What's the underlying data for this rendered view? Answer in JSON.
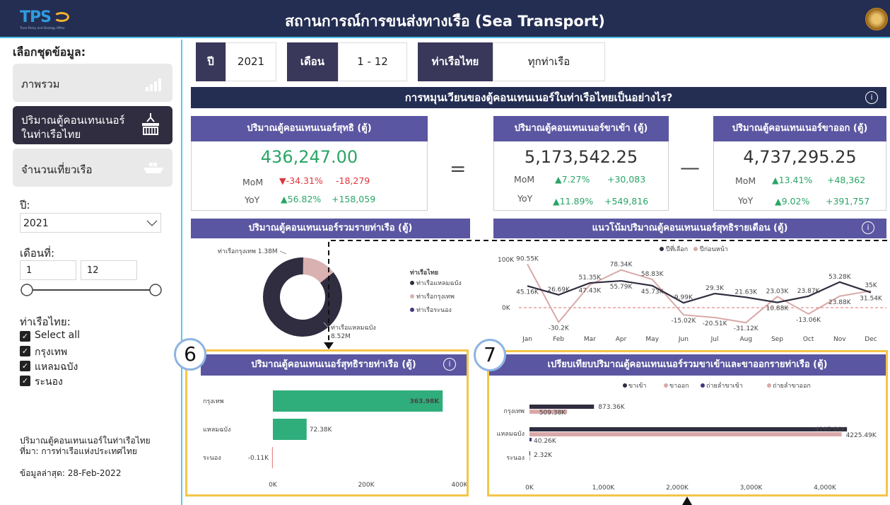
{
  "header": {
    "logo_text": "TPS",
    "logo_sub": "Trans Policy and Strategy Office",
    "title": "สถานการณ์การขนส่งทางเรือ (Sea Transport)"
  },
  "sidebar": {
    "select_title": "เลือกชุดข้อมูล:",
    "buttons": [
      {
        "label": "ภาพรวม",
        "icon": "bar-chart-icon",
        "active": false
      },
      {
        "label_line1": "ปริมาณตู้คอนเทนเนอร์",
        "label_line2": "ในท่าเรือไทย",
        "icon": "container-crane-icon",
        "active": true
      },
      {
        "label": "จำนวนเที่ยวเรือ",
        "icon": "ship-icon",
        "active": false
      }
    ],
    "year_label": "ปี:",
    "year_value": "2021",
    "month_label": "เดือนที่:",
    "month_from": "1",
    "month_to": "12",
    "port_label": "ท่าเรือไทย:",
    "ports": [
      "Select all",
      "กรุงเทพ",
      "แหลมฉบัง",
      "ระนอง"
    ],
    "note_line1": "ปริมาณตู้คอนเทนเนอร์ในท่าเรือไทย",
    "note_line2": "ที่มา: การท่าเรือแห่งประเทศไทย",
    "updated": "ข้อมูลล่าสุด: 28-Feb-2022"
  },
  "filters": {
    "year_label": "ปี",
    "year_value": "2021",
    "month_label": "เดือน",
    "month_value": "1 - 12",
    "port_label": "ท่าเรือไทย",
    "port_value": "ทุกท่าเรือ"
  },
  "banner": {
    "title": "การหมุนเวียนของตู้คอนเทนเนอร์ในท่าเรือไทยเป็นอย่างไร?",
    "info": "i"
  },
  "kpis": {
    "net": {
      "title": "ปริมาณตู้คอนเทนเนอร์สุทธิ (ตู้)",
      "value": "436,247.00",
      "mom_label": "MoM",
      "mom_pct": "▼-34.31%",
      "mom_abs": "-18,279",
      "yoy_label": "YoY",
      "yoy_pct": "▲56.82%",
      "yoy_abs": "+158,059"
    },
    "equals": "=",
    "minus": "—",
    "import": {
      "title": "ปริมาณตู้คอนเทนเนอร์ขาเข้า (ตู้)",
      "value": "5,173,542.25",
      "mom_label": "MoM",
      "mom_pct": "▲7.27%",
      "mom_abs": "+30,083",
      "yoy_label": "YoY",
      "yoy_pct": "▲11.89%",
      "yoy_abs": "+549,816"
    },
    "export": {
      "title": "ปริมาณตู้คอนเทนเนอร์ขาออก (ตู้)",
      "value": "4,737,295.25",
      "mom_label": "MoM",
      "mom_pct": "▲13.41%",
      "mom_abs": "+48,362",
      "yoy_label": "YoY",
      "yoy_pct": "▲9.02%",
      "yoy_abs": "+391,757"
    }
  },
  "chart_data": [
    {
      "type": "pie",
      "title": "ปริมาณตู้คอนเทนเนอร์รวมรายท่าเรือ (ตู้)",
      "legend_title": "ท่าเรือไทย",
      "legend_position": "right",
      "slices": [
        {
          "name": "ท่าเรือแหลมฉบัง",
          "label": "ท่าเรือแหลมฉบัง 8.52M",
          "value": 8.52,
          "color": "#2f2d3f"
        },
        {
          "name": "ท่าเรือกรุงเทพ",
          "label": "ท่าเรือกรุงเทพ 1.38M",
          "value": 1.38,
          "color": "#d9b1b1"
        },
        {
          "name": "ท่าเรือระนอง",
          "label": "",
          "value": 0.004,
          "color": "#3c3a7a"
        }
      ]
    },
    {
      "type": "line",
      "title": "แนวโน้มปริมาณตู้คอนเทนเนอร์สุทธิรายเดือน (ตู้)",
      "legend_position": "top",
      "categories": [
        "Jan",
        "Feb",
        "Mar",
        "Apr",
        "May",
        "Jun",
        "Jul",
        "Aug",
        "Sep",
        "Oct",
        "Nov",
        "Dec"
      ],
      "y_ticks": [
        "100K",
        "0K"
      ],
      "ylim": [
        -50,
        110
      ],
      "grid": false,
      "series": [
        {
          "name": "ปีที่เลือก",
          "color": "#2f2d3f",
          "values": [
            45.16,
            26.69,
            51.35,
            55.79,
            45.73,
            9.99,
            29.3,
            21.63,
            10.88,
            23.87,
            53.28,
            31.54
          ],
          "labels": [
            "45.16K",
            "26.69K",
            "51.35K",
            "55.79K",
            "45.73K",
            "9.99K",
            "29.3K",
            "21.63K",
            "10.88K",
            "23.87K",
            "53.28K",
            "31.54K"
          ]
        },
        {
          "name": "ปีก่อนหน้า",
          "color": "#d9a8a8",
          "values": [
            90.55,
            -30.2,
            47.43,
            78.34,
            58.83,
            -15.02,
            -20.51,
            -31.12,
            23.03,
            -13.06,
            23.88,
            35
          ],
          "labels": [
            "90.55K",
            "-30.2K",
            "47.43K",
            "78.34K",
            "58.83K",
            "-15.02K",
            "-20.51K",
            "-31.12K",
            "23.03K",
            "-13.06K",
            "23.88K",
            "35K"
          ]
        }
      ]
    },
    {
      "type": "bar",
      "title": "ปริมาณตู้คอนเทนเนอร์สุทธิรายท่าเรือ (ตู้)",
      "orientation": "horizontal",
      "categories": [
        "กรุงเทพ",
        "แหลมฉบัง",
        "ระนอง"
      ],
      "values": [
        363.98,
        72.38,
        -0.11
      ],
      "labels": [
        "363.98K",
        "72.38K",
        "-0.11K"
      ],
      "x_ticks": [
        "0K",
        "200K",
        "400K"
      ],
      "xlim": [
        0,
        400
      ],
      "color": "#2fae7c"
    },
    {
      "type": "bar",
      "title": "เปรียบเทียบปริมาณตู้คอนเทนเนอร์รวมขาเข้าและขาออกรายท่าเรือ (ตู้)",
      "orientation": "horizontal",
      "categories": [
        "กรุงเทพ",
        "แหลมฉบัง",
        "ระนอง"
      ],
      "x_ticks": [
        "0K",
        "1,000K",
        "2,000K",
        "3,000K",
        "4,000K"
      ],
      "xlim": [
        0,
        4800
      ],
      "legend_position": "top",
      "legend": [
        "ขาเข้า",
        "ขาออก",
        "ถ่ายลำขาเข้า",
        "ถ่ายลำขาออก"
      ],
      "series": [
        {
          "name": "ขาเข้า",
          "color": "#2f2d3f",
          "values": [
            873.36,
            4297.86,
            2.32
          ],
          "labels": [
            "873.36K",
            "4297.86K",
            "2.32K"
          ]
        },
        {
          "name": "ขาออก",
          "color": "#d9a8a8",
          "values": [
            509.38,
            4225.49,
            2.32
          ],
          "labels": [
            "509.38K",
            "4225.49K",
            ""
          ]
        }
      ],
      "extra_labels": [
        "40.26K"
      ]
    }
  ],
  "badges": {
    "six": "6",
    "seven": "7"
  },
  "colors": {
    "header": "#242d52",
    "accent": "#5b56a1",
    "highlight": "#f5c54a",
    "green": "#2aa567",
    "red": "#e0343c"
  }
}
